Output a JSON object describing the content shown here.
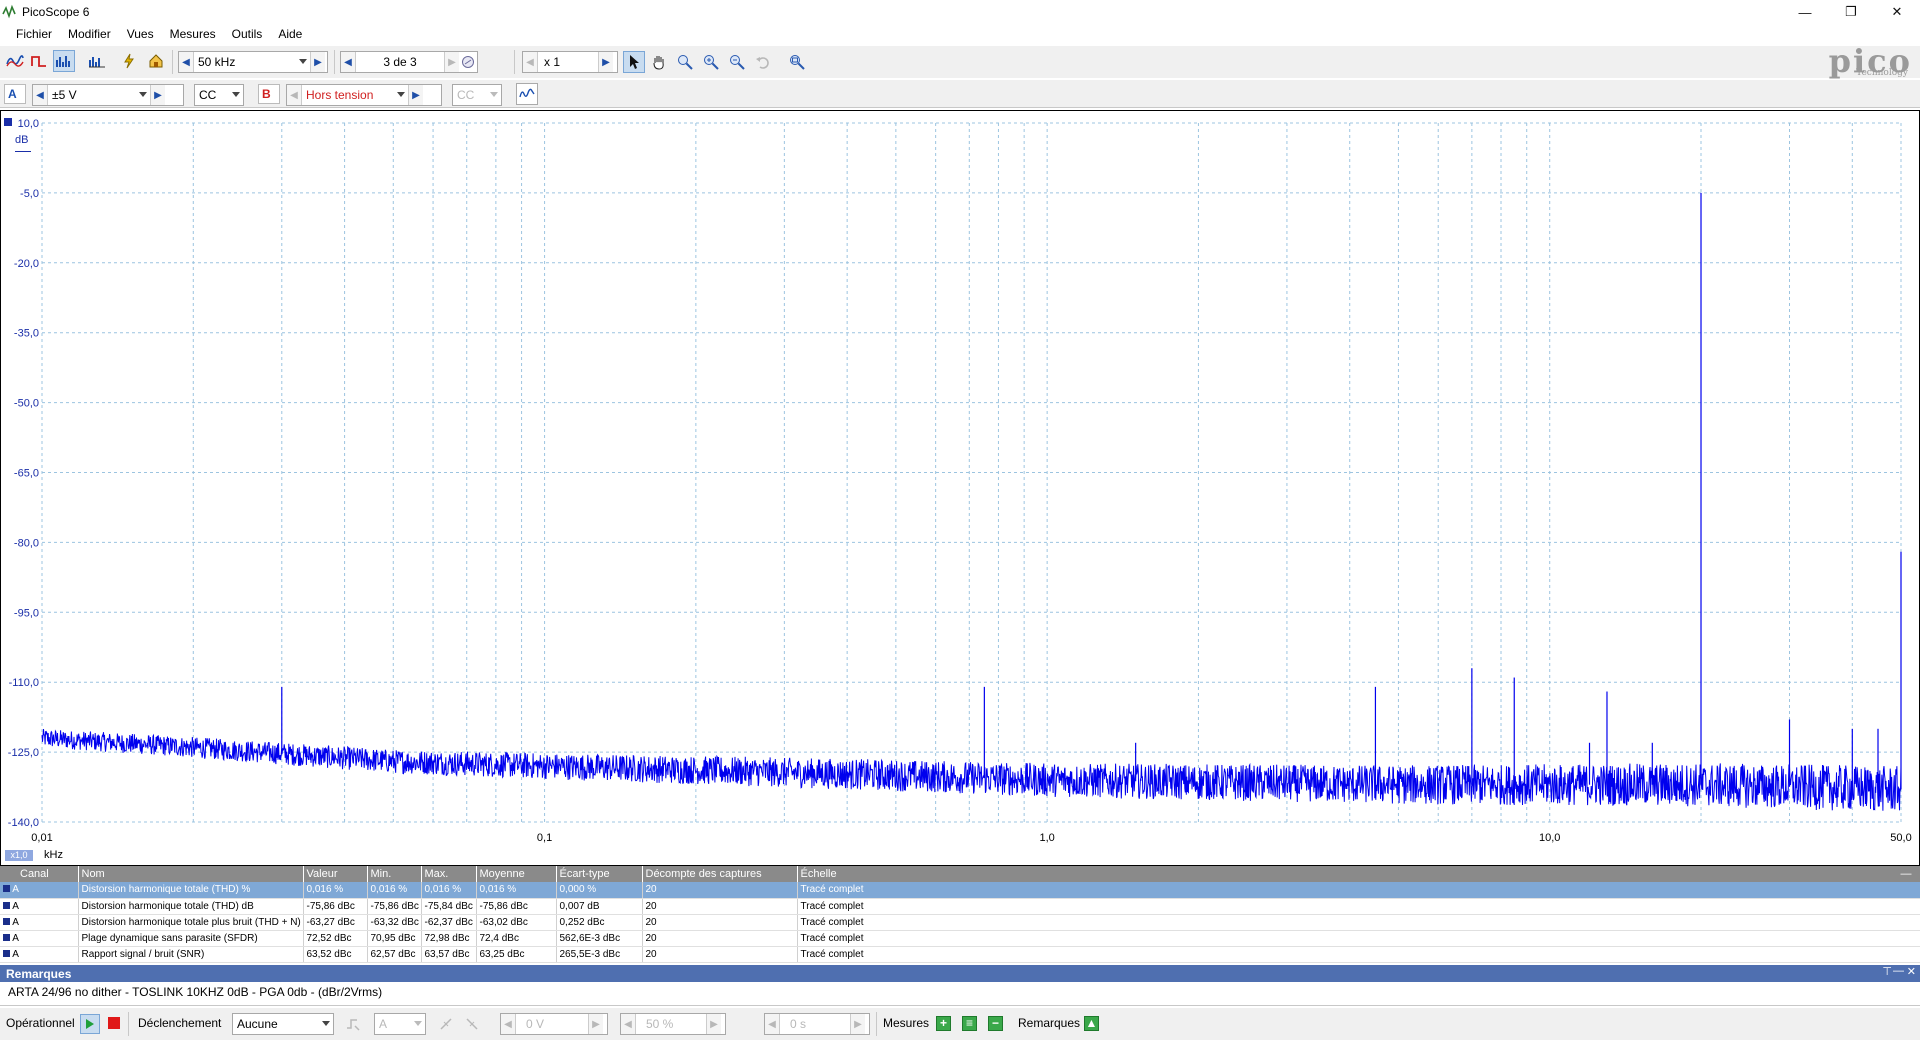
{
  "window": {
    "title": "PicoScope 6",
    "minimize": "—",
    "maximize": "❐",
    "close": "✕"
  },
  "menu": [
    "Fichier",
    "Modifier",
    "Vues",
    "Mesures",
    "Outils",
    "Aide"
  ],
  "toolbar": {
    "timebase": "50 kHz",
    "capture_counter": "3 de 3",
    "zoom_factor": "x 1",
    "logo_text": "pico",
    "logo_sub": "Technology"
  },
  "channel_a": {
    "label": "A",
    "range": "±5 V",
    "coupling": "CC"
  },
  "channel_b": {
    "label": "B",
    "range": "Hors tension",
    "coupling": "CC"
  },
  "chart_data": {
    "type": "line",
    "subtype": "spectrum",
    "x_scale": "log",
    "x_label": "kHz",
    "x_ticks": [
      "0,01",
      "0,1",
      "1,0",
      "10,0",
      "50,0"
    ],
    "xlim": [
      0.01,
      50.0
    ],
    "y_label": "dB",
    "y_ticks": [
      "10,0",
      "-5,0",
      "-20,0",
      "-35,0",
      "-50,0",
      "-65,0",
      "-80,0",
      "-95,0",
      "-110,0",
      "-125,0",
      "-140,0"
    ],
    "ylim": [
      -140,
      10
    ],
    "x_multiplier": "x1,0",
    "grid": true,
    "series": [
      {
        "channel": "A",
        "color": "#0000ee",
        "noise_floor": [
          [
            0.01,
            -122
          ],
          [
            0.02,
            -124
          ],
          [
            0.05,
            -127
          ],
          [
            0.1,
            -128
          ],
          [
            0.5,
            -130
          ],
          [
            1.0,
            -131
          ],
          [
            5.0,
            -132
          ],
          [
            20.0,
            -132
          ],
          [
            50.0,
            -133
          ]
        ],
        "peaks": [
          [
            0.03,
            -111
          ],
          [
            0.75,
            -111
          ],
          [
            1.5,
            -123
          ],
          [
            4.5,
            -111
          ],
          [
            7.0,
            -107
          ],
          [
            8.5,
            -109
          ],
          [
            12.0,
            -123
          ],
          [
            13.0,
            -112
          ],
          [
            16.0,
            -123
          ],
          [
            20.0,
            -5
          ],
          [
            30.0,
            -118
          ],
          [
            40.0,
            -120
          ],
          [
            45.0,
            -120
          ],
          [
            50.0,
            -82
          ]
        ]
      }
    ]
  },
  "measurements": {
    "headers": [
      "Canal",
      "Nom",
      "Valeur",
      "Min.",
      "Max.",
      "Moyenne",
      "Écart-type",
      "Décompte des captures",
      "Échelle"
    ],
    "rows": [
      [
        "A",
        "Distorsion harmonique totale (THD) %",
        "0,016 %",
        "0,016 %",
        "0,016 %",
        "0,016 %",
        "0,000 %",
        "20",
        "Tracé complet"
      ],
      [
        "A",
        "Distorsion harmonique totale (THD) dB",
        "-75,86 dBc",
        "-75,86 dBc",
        "-75,84 dBc",
        "-75,86 dBc",
        "0,007 dB",
        "20",
        "Tracé complet"
      ],
      [
        "A",
        "Distorsion harmonique totale plus bruit (THD + N)",
        "-63,27 dBc",
        "-63,32 dBc",
        "-62,37 dBc",
        "-63,02 dBc",
        "0,252 dBc",
        "20",
        "Tracé complet"
      ],
      [
        "A",
        "Plage dynamique sans parasite (SFDR)",
        "72,52 dBc",
        "70,95 dBc",
        "72,98 dBc",
        "72,4 dBc",
        "562,6E-3 dBc",
        "20",
        "Tracé complet"
      ],
      [
        "A",
        "Rapport signal / bruit (SNR)",
        "63,52 dBc",
        "62,57 dBc",
        "63,57 dBc",
        "63,25 dBc",
        "265,5E-3 dBc",
        "20",
        "Tracé complet"
      ]
    ]
  },
  "remarks": {
    "title": "Remarques",
    "text": "ARTA 24/96 no dither - TOSLINK 10KHZ 0dB - PGA 0db  - (dBr/2Vrms)"
  },
  "status": {
    "mode": "Opérationnel",
    "trigger_label": "Déclenchement",
    "trigger_value": "Aucune",
    "trigger_channel": "A",
    "trigger_level": "0 V",
    "pretrigger": "50 %",
    "delay": "0 s",
    "measures_label": "Mesures",
    "remarks_label": "Remarques"
  }
}
